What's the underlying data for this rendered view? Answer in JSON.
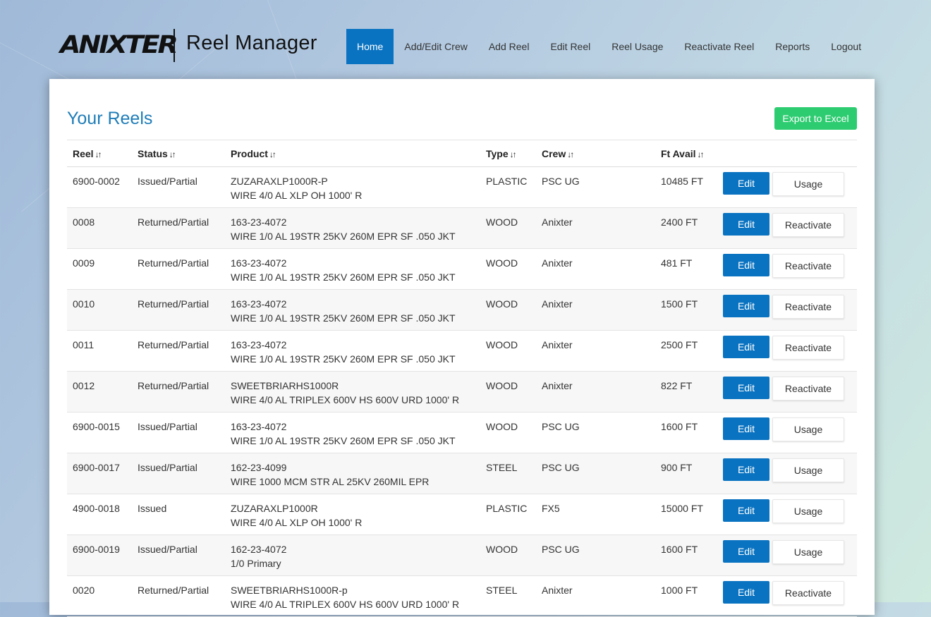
{
  "brand": {
    "logo_text": "ANIXTER",
    "app_title": "Reel Manager"
  },
  "nav": [
    {
      "label": "Home",
      "active": true
    },
    {
      "label": "Add/Edit Crew"
    },
    {
      "label": "Add Reel"
    },
    {
      "label": "Edit Reel"
    },
    {
      "label": "Reel Usage"
    },
    {
      "label": "Reactivate Reel"
    },
    {
      "label": "Reports"
    },
    {
      "label": "Logout"
    }
  ],
  "main": {
    "title": "Your Reels",
    "export_label": "Export to Excel",
    "columns": [
      "Reel",
      "Status",
      "Product",
      "Type",
      "Crew",
      "Ft Avail"
    ],
    "edit_label": "Edit",
    "rows": [
      {
        "reel": "6900-0002",
        "status": "Issued/Partial",
        "product_code": "ZUZARAXLP1000R-P",
        "product_desc": "WIRE 4/0 AL XLP OH 1000' R",
        "type": "PLASTIC",
        "crew": "PSC UG",
        "ft": "10485 FT",
        "action": "Usage"
      },
      {
        "reel": "0008",
        "status": "Returned/Partial",
        "product_code": "163-23-4072",
        "product_desc": "WIRE 1/0 AL 19STR 25KV 260M EPR SF .050 JKT",
        "type": "WOOD",
        "crew": "Anixter",
        "ft": "2400 FT",
        "action": "Reactivate"
      },
      {
        "reel": "0009",
        "status": "Returned/Partial",
        "product_code": "163-23-4072",
        "product_desc": "WIRE 1/0 AL 19STR 25KV 260M EPR SF .050 JKT",
        "type": "WOOD",
        "crew": "Anixter",
        "ft": "481 FT",
        "action": "Reactivate"
      },
      {
        "reel": "0010",
        "status": "Returned/Partial",
        "product_code": "163-23-4072",
        "product_desc": "WIRE 1/0 AL 19STR 25KV 260M EPR SF .050 JKT",
        "type": "WOOD",
        "crew": "Anixter",
        "ft": "1500 FT",
        "action": "Reactivate"
      },
      {
        "reel": "0011",
        "status": "Returned/Partial",
        "product_code": "163-23-4072",
        "product_desc": "WIRE 1/0 AL 19STR 25KV 260M EPR SF .050 JKT",
        "type": "WOOD",
        "crew": "Anixter",
        "ft": "2500 FT",
        "action": "Reactivate"
      },
      {
        "reel": "0012",
        "status": "Returned/Partial",
        "product_code": "SWEETBRIARHS1000R",
        "product_desc": "WIRE 4/0 AL TRIPLEX 600V HS 600V URD 1000' R",
        "type": "WOOD",
        "crew": "Anixter",
        "ft": "822 FT",
        "action": "Reactivate"
      },
      {
        "reel": "6900-0015",
        "status": "Issued/Partial",
        "product_code": "163-23-4072",
        "product_desc": "WIRE 1/0 AL 19STR 25KV 260M EPR SF .050 JKT",
        "type": "WOOD",
        "crew": "PSC UG",
        "ft": "1600 FT",
        "action": "Usage"
      },
      {
        "reel": "6900-0017",
        "status": "Issued/Partial",
        "product_code": "162-23-4099",
        "product_desc": "WIRE 1000 MCM STR AL 25KV 260MIL EPR",
        "type": "STEEL",
        "crew": "PSC UG",
        "ft": "900 FT",
        "action": "Usage"
      },
      {
        "reel": "4900-0018",
        "status": "Issued",
        "product_code": "ZUZARAXLP1000R",
        "product_desc": "WIRE 4/0 AL XLP OH 1000' R",
        "type": "PLASTIC",
        "crew": "FX5",
        "ft": "15000 FT",
        "action": "Usage"
      },
      {
        "reel": "6900-0019",
        "status": "Issued/Partial",
        "product_code": "162-23-4072",
        "product_desc": "1/0 Primary",
        "type": "WOOD",
        "crew": "PSC UG",
        "ft": "1600 FT",
        "action": "Usage"
      },
      {
        "reel": "0020",
        "status": "Returned/Partial",
        "product_code": "SWEETBRIARHS1000R-p",
        "product_desc": "WIRE 4/0 AL TRIPLEX 600V HS 600V URD 1000' R",
        "type": "STEEL",
        "crew": "Anixter",
        "ft": "1000 FT",
        "action": "Reactivate"
      }
    ]
  },
  "colors": {
    "primary": "#0a73c1",
    "success": "#2ecc71",
    "title": "#1f7db8"
  },
  "icons": {
    "sort": "sort-icon"
  }
}
